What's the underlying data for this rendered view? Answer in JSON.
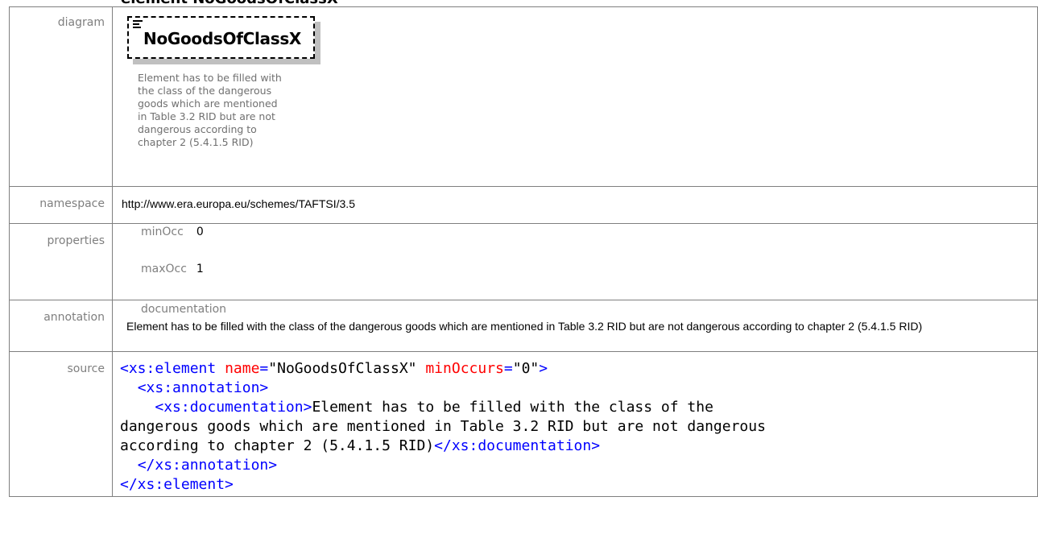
{
  "header_fragment": "element NoGoodsOfClassX",
  "rows": {
    "diagram_label": "diagram",
    "namespace_label": "namespace",
    "properties_label": "properties",
    "annotation_label": "annotation",
    "source_label": "source"
  },
  "diagram": {
    "element_name": "NoGoodsOfClassX",
    "doc_lines": [
      "Element has to be filled with",
      "the class of the dangerous",
      "goods which are mentioned",
      "in Table 3.2 RID but are not",
      "dangerous according to",
      "chapter 2 (5.4.1.5 RID)"
    ],
    "icon": "sequence-list-icon"
  },
  "namespace": "http://www.era.europa.eu/schemes/TAFTSI/3.5",
  "properties": [
    {
      "key": "minOcc",
      "value": "0"
    },
    {
      "key": "maxOcc",
      "value": "1"
    }
  ],
  "annotation": {
    "heading": "documentation",
    "text": "Element has to be filled with the class of the dangerous goods which are mentioned in Table 3.2 RID but are not dangerous according to chapter 2 (5.4.1.5 RID)"
  },
  "source": {
    "line1_open": "<xs:element",
    "attr1_name": "name",
    "attr1_value": "\"NoGoodsOfClassX\"",
    "attr2_name": "minOccurs",
    "attr2_value": "\"0\"",
    "line1_close": ">",
    "line2": "<xs:annotation>",
    "line3_open": "<xs:documentation>",
    "doc_line1": "Element has to be filled with the class of the",
    "doc_line2": "dangerous goods which are mentioned in Table 3.2 RID but are not dangerous",
    "doc_line3": "according to chapter 2 (5.4.1.5 RID)",
    "line3_close": "</xs:documentation>",
    "line4": "</xs:annotation>",
    "line5": "</xs:element>"
  },
  "colors": {
    "tag": "#0000ff",
    "attribute": "#ff0000",
    "label": "#7f7f7f",
    "border": "#7f7f7f"
  }
}
